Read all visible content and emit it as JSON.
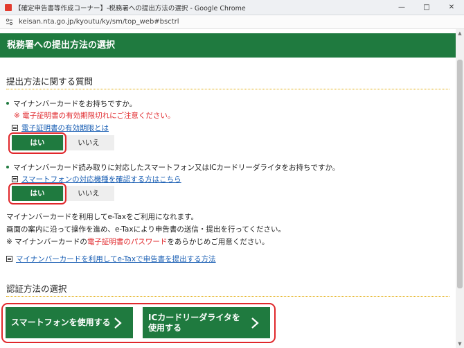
{
  "window": {
    "title": "【確定申告書等作成コーナー】-税務署への提出方法の選択 - Google Chrome",
    "url": "keisan.nta.go.jp/kyoutu/ky/sm/top_web#bsctrl"
  },
  "page": {
    "header": "税務署への提出方法の選択",
    "section1_title": "提出方法に関する質問",
    "q1": {
      "text": "マイナンバーカードをお持ちですか。",
      "warning": "※ 電子証明書の有効期限切れにご注意ください。",
      "link": "電子証明書の有効期限とは",
      "yes": "はい",
      "no": "いいえ"
    },
    "q2": {
      "text": "マイナンバーカード読み取りに対応したスマートフォン又はICカードリーダライタをお持ちですか。",
      "link": "スマートフォンの対応機種を確認する方はこちら",
      "yes": "はい",
      "no": "いいえ"
    },
    "info": {
      "line1": "マイナンバーカードを利用してe-Taxをご利用になれます。",
      "line2": "画面の案内に沿って操作を進め、e-Taxにより申告書の送信・提出を行ってください。",
      "line3_pre": "※ マイナンバーカードの",
      "line3_red": "電子証明書のパスワード",
      "line3_post": "をあらかじめご用意ください。"
    },
    "link_etax": "マイナンバーカードを利用してe-Taxで申告書を提出する方法",
    "section2_title": "認証方法の選択",
    "btn_smartphone": "スマートフォンを使用する",
    "btn_icreader_l1": "ICカードリーダライタを",
    "btn_icreader_l2": "使用する"
  },
  "colors": {
    "brand_green": "#1f7a3f",
    "highlight_red": "#e0272b",
    "link_blue": "#1a5fb4"
  }
}
